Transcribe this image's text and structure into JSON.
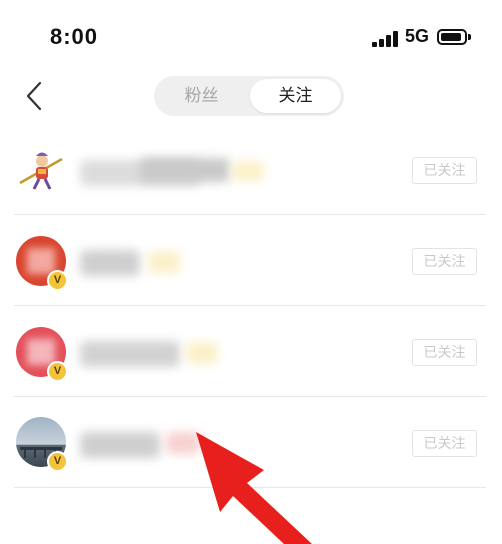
{
  "status": {
    "time": "8:00",
    "network": "5G"
  },
  "tabs": [
    {
      "label": "粉丝",
      "active": false
    },
    {
      "label": "关注",
      "active": true
    }
  ],
  "list": {
    "follow_label": "已关注",
    "badge_label": "V"
  },
  "colors": {
    "accent_arrow": "#e8201d",
    "tab_inactive": "#a7a7a7",
    "button_border": "#e3e3e3"
  },
  "icons": [
    "back-chevron-icon",
    "signal-icon",
    "battery-icon",
    "verified-badge-icon"
  ]
}
